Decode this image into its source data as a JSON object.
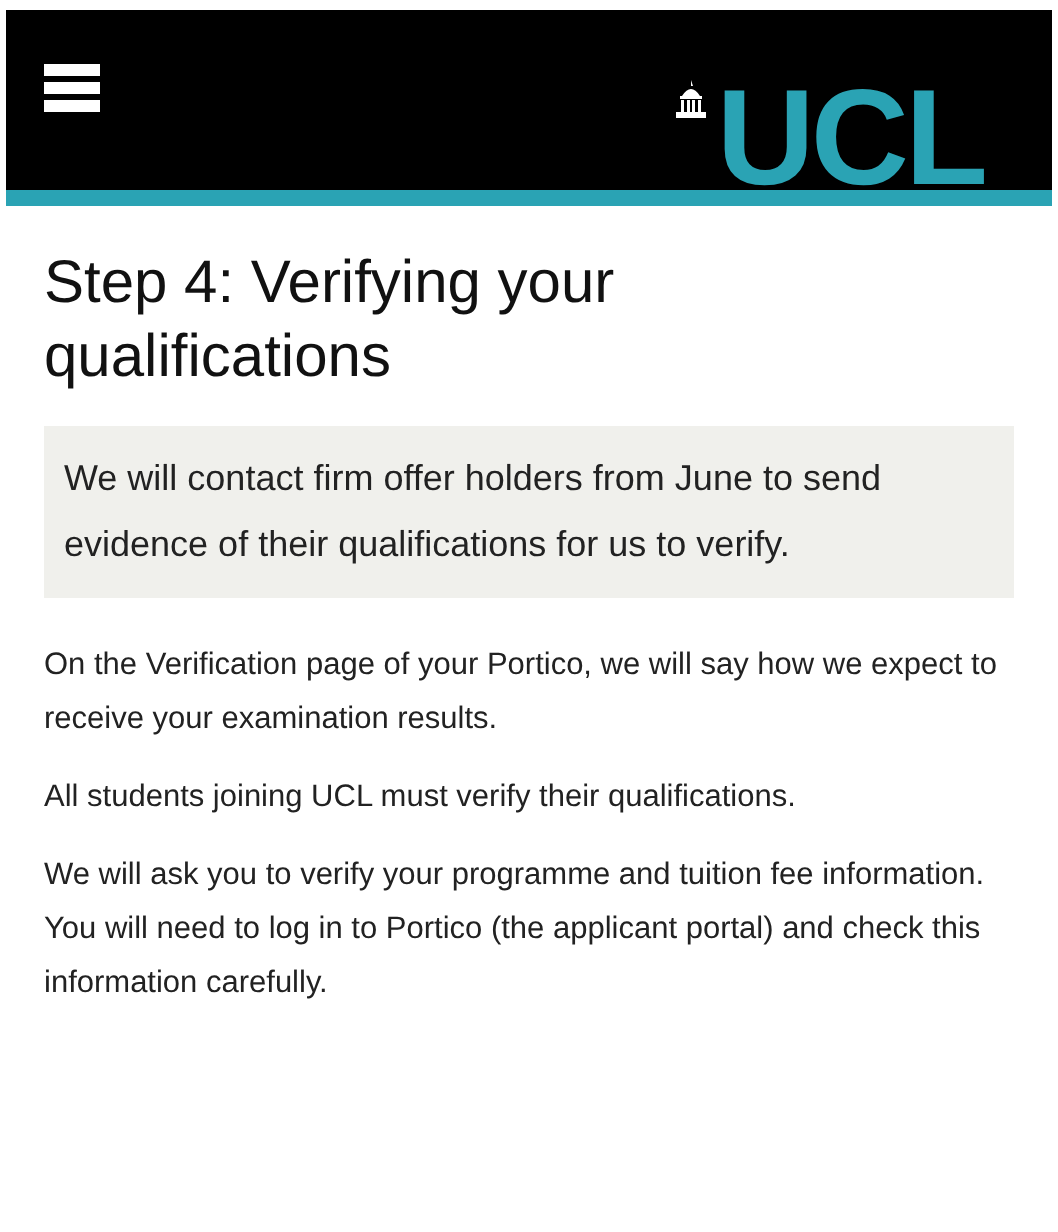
{
  "header": {
    "logo": "UCL"
  },
  "heading": "Step 4: Verifying your qualifications",
  "callout": "We will contact firm offer holders from June to send evidence of their qualifications for us to verify.",
  "paragraphs": [
    "On the Verification page of your Portico, we will say how we expect to receive your examination results.",
    "All students joining UCL must verify their qualifications.",
    "We will ask you to verify your programme and tuition fee information. You will need to log in to Portico (the applicant portal) and check this information carefully."
  ]
}
